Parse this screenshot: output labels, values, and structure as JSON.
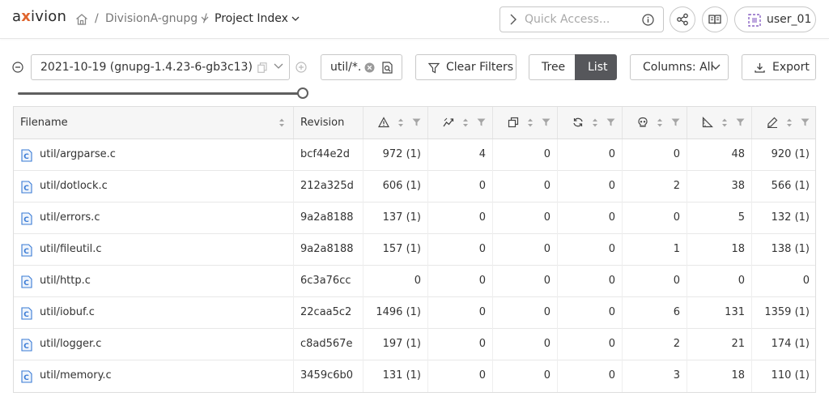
{
  "header": {
    "logo_pre": "a",
    "logo_x": "x",
    "logo_post": "ivion",
    "breadcrumb": [
      {
        "label": "DivisionA-gnupg"
      },
      {
        "label": "Project Index"
      }
    ],
    "breadcrumb_sep": "/",
    "quick_access_placeholder": "Quick Access...",
    "user": "user_01"
  },
  "toolbar": {
    "version": "2021-10-19 (gnupg-1.4.23-6-gb3c13)",
    "filter_value": "util/*.",
    "clear_filters": "Clear Filters",
    "tree": "Tree",
    "list": "List",
    "columns": "Columns: All",
    "export": "Export",
    "slider_position": 1.0
  },
  "table": {
    "columns": {
      "filename": "Filename",
      "revision": "Revision"
    },
    "metric_icons": [
      "warning-icon",
      "trend-icon",
      "clone-icon",
      "cycle-icon",
      "skull-icon",
      "metric-icon",
      "style-icon"
    ],
    "rows": [
      {
        "file": "util/argparse.c",
        "rev": "bcf44e2d",
        "m": [
          "972 (1)",
          "4",
          "0",
          "0",
          "0",
          "48",
          "920 (1)"
        ]
      },
      {
        "file": "util/dotlock.c",
        "rev": "212a325d",
        "m": [
          "606 (1)",
          "0",
          "0",
          "0",
          "2",
          "38",
          "566 (1)"
        ]
      },
      {
        "file": "util/errors.c",
        "rev": "9a2a8188",
        "m": [
          "137 (1)",
          "0",
          "0",
          "0",
          "0",
          "5",
          "132 (1)"
        ]
      },
      {
        "file": "util/fileutil.c",
        "rev": "9a2a8188",
        "m": [
          "157 (1)",
          "0",
          "0",
          "0",
          "1",
          "18",
          "138 (1)"
        ]
      },
      {
        "file": "util/http.c",
        "rev": "6c3a76cc",
        "m": [
          "0",
          "0",
          "0",
          "0",
          "0",
          "0",
          "0"
        ]
      },
      {
        "file": "util/iobuf.c",
        "rev": "22caa5c2",
        "m": [
          "1496 (1)",
          "0",
          "0",
          "0",
          "6",
          "131",
          "1359 (1)"
        ]
      },
      {
        "file": "util/logger.c",
        "rev": "c8ad567e",
        "m": [
          "197 (1)",
          "0",
          "0",
          "0",
          "2",
          "21",
          "174 (1)"
        ]
      },
      {
        "file": "util/memory.c",
        "rev": "3459c6b0",
        "m": [
          "131 (1)",
          "0",
          "0",
          "0",
          "3",
          "18",
          "110 (1)"
        ]
      }
    ]
  },
  "colors": {
    "accent": "#e0662f",
    "active_toggle": "#56575b",
    "file_icon": "#3a7bd5"
  }
}
